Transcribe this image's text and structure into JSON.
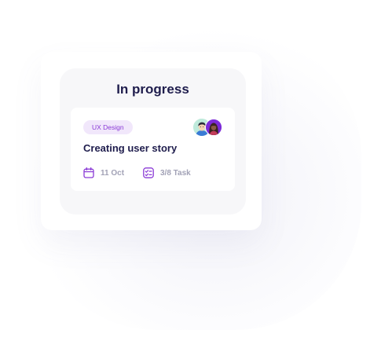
{
  "column": {
    "title": "In progress"
  },
  "card": {
    "tag": "UX Design",
    "title": "Creating user story",
    "date": "11 Oct",
    "tasks": "3/8 Task",
    "icons": {
      "date": "calendar-icon",
      "tasks": "checklist-icon"
    }
  },
  "colors": {
    "title": "#1f1d4d",
    "accent": "#8a3ad6",
    "tag_bg": "#f1e7fb",
    "meta_text": "#a2a2b6"
  }
}
